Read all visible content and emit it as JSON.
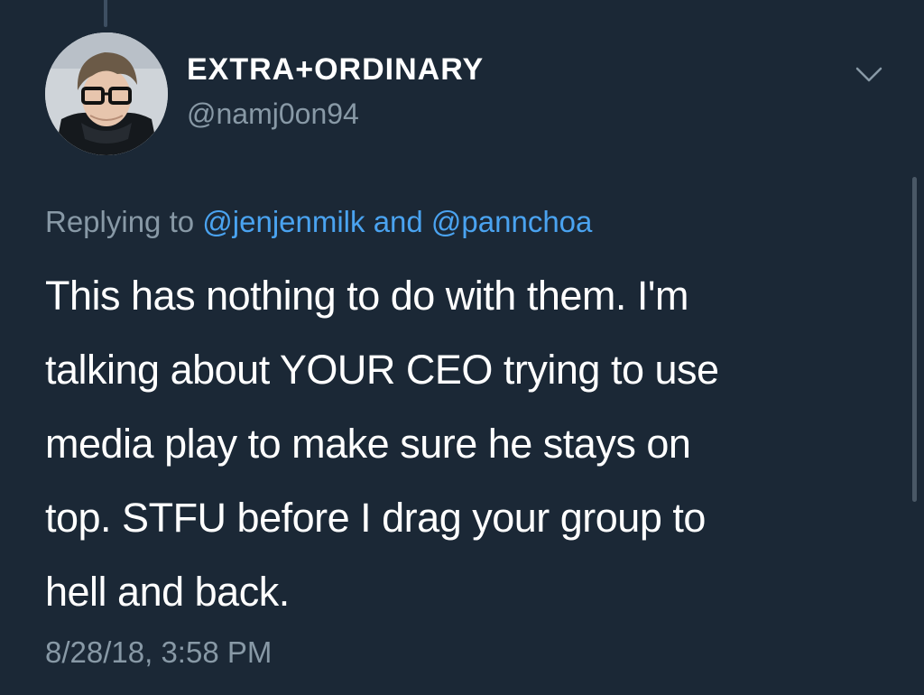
{
  "tweet": {
    "display_name": "EXTRA+ORDINARY",
    "handle": "@namj0on94",
    "reply_prefix": "Replying to",
    "reply_to": [
      "@jenjenmilk",
      "@pannchoa"
    ],
    "reply_joiner": "and",
    "text_lines": [
      "This has nothing to do with them. I'm",
      "talking about YOUR CEO trying to use",
      "media play to make sure he stays on",
      "top. STFU before I drag your group to",
      "hell and back."
    ],
    "timestamp": "8/28/18, 3:58 PM"
  },
  "icons": {
    "menu": "chevron-down-icon"
  },
  "colors": {
    "background": "#1b2836",
    "primary_text": "#ffffff",
    "secondary_text": "#8899a6",
    "mention": "#4aa3f0"
  }
}
